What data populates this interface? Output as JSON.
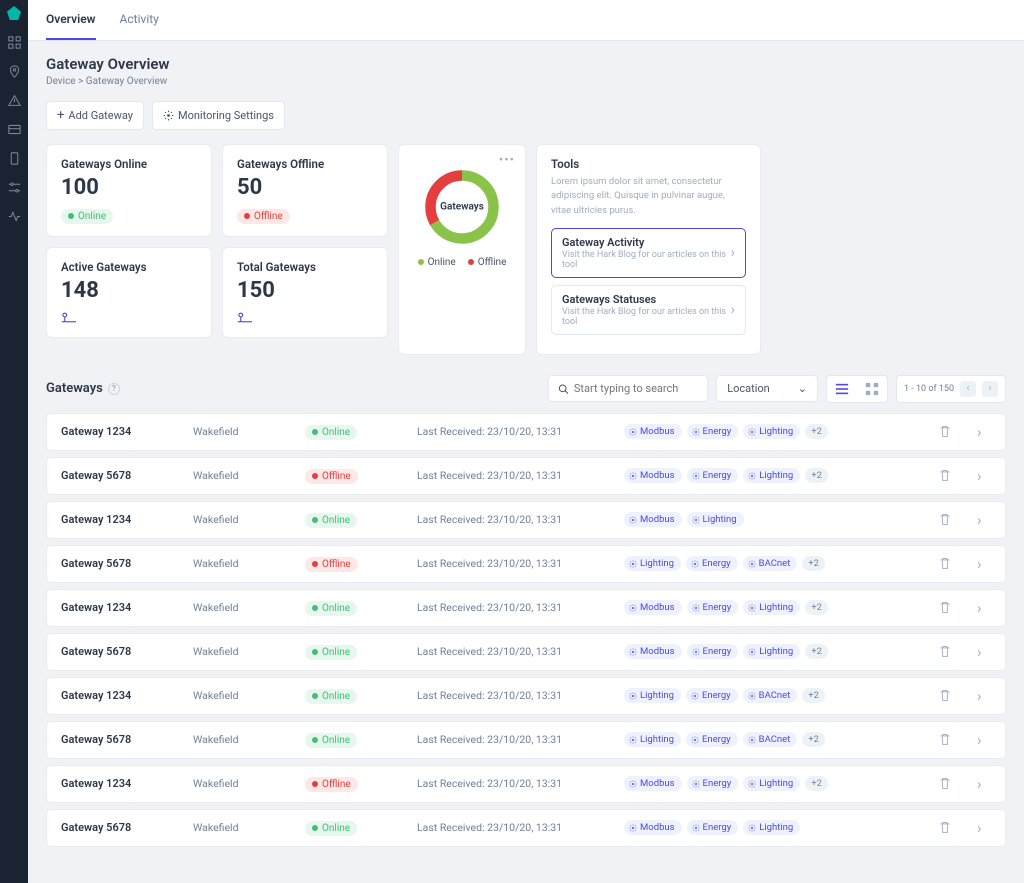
{
  "tabs": {
    "overview": "Overview",
    "activity": "Activity"
  },
  "page": {
    "title": "Gateway Overview",
    "breadcrumb": "Device > Gateway Overview",
    "add_btn": "Add Gateway",
    "monitor_btn": "Monitoring Settings"
  },
  "stats": {
    "online": {
      "label": "Gateways Online",
      "value": "100",
      "badge": "Online"
    },
    "offline": {
      "label": "Gateways Offline",
      "value": "50",
      "badge": "Offline"
    },
    "active": {
      "label": "Active Gateways",
      "value": "148"
    },
    "total": {
      "label": "Total Gateways",
      "value": "150"
    }
  },
  "chart_data": {
    "type": "pie",
    "title": "Gateways",
    "series": [
      {
        "name": "Online",
        "value": 100,
        "color": "#8bc34a"
      },
      {
        "name": "Offline",
        "value": 50,
        "color": "#e53e3e"
      }
    ],
    "legend": {
      "online": "Online",
      "offline": "Offline"
    }
  },
  "tools": {
    "title": "Tools",
    "desc": "Lorem ipsum dolor sit amet, consectetur adipiscing elit. Quisque in pulvinar augue, vitae ultricies purus.",
    "items": [
      {
        "title": "Gateway Activity",
        "sub": "Visit the Hark Blog for our articles on this tool"
      },
      {
        "title": "Gateways Statuses",
        "sub": "Visit the Hark Blog for our articles on this tool"
      }
    ]
  },
  "list": {
    "heading": "Gateways",
    "search_placeholder": "Start typing to search",
    "location_label": "Location",
    "pager": "1 - 10 of 150"
  },
  "rows": [
    {
      "name": "Gateway 1234",
      "loc": "Wakefield",
      "status": "Online",
      "received": "Last Received: 23/10/20, 13:31",
      "tags": [
        "Modbus",
        "Energy",
        "Lighting"
      ],
      "more": "+2"
    },
    {
      "name": "Gateway 5678",
      "loc": "Wakefield",
      "status": "Offline",
      "received": "Last Received: 23/10/20, 13:31",
      "tags": [
        "Modbus",
        "Energy",
        "Lighting"
      ],
      "more": "+2"
    },
    {
      "name": "Gateway 1234",
      "loc": "Wakefield",
      "status": "Online",
      "received": "Last Received: 23/10/20, 13:31",
      "tags": [
        "Modbus",
        "Lighting"
      ],
      "more": ""
    },
    {
      "name": "Gateway 5678",
      "loc": "Wakefield",
      "status": "Offline",
      "received": "Last Received: 23/10/20, 13:31",
      "tags": [
        "Lighting",
        "Energy",
        "BACnet"
      ],
      "more": "+2"
    },
    {
      "name": "Gateway 1234",
      "loc": "Wakefield",
      "status": "Online",
      "received": "Last Received: 23/10/20, 13:31",
      "tags": [
        "Modbus",
        "Energy",
        "Lighting"
      ],
      "more": "+2"
    },
    {
      "name": "Gateway 5678",
      "loc": "Wakefield",
      "status": "Online",
      "received": "Last Received: 23/10/20, 13:31",
      "tags": [
        "Modbus",
        "Energy",
        "Lighting"
      ],
      "more": "+2"
    },
    {
      "name": "Gateway 1234",
      "loc": "Wakefield",
      "status": "Online",
      "received": "Last Received: 23/10/20, 13:31",
      "tags": [
        "Lighting",
        "Energy",
        "BACnet"
      ],
      "more": "+2"
    },
    {
      "name": "Gateway 5678",
      "loc": "Wakefield",
      "status": "Online",
      "received": "Last Received: 23/10/20, 13:31",
      "tags": [
        "Lighting",
        "Energy",
        "BACnet"
      ],
      "more": "+2"
    },
    {
      "name": "Gateway 1234",
      "loc": "Wakefield",
      "status": "Offline",
      "received": "Last Received: 23/10/20, 13:31",
      "tags": [
        "Modbus",
        "Energy",
        "Lighting"
      ],
      "more": "+2"
    },
    {
      "name": "Gateway 5678",
      "loc": "Wakefield",
      "status": "Online",
      "received": "Last Received: 23/10/20, 13:31",
      "tags": [
        "Modbus",
        "Energy",
        "Lighting"
      ],
      "more": ""
    }
  ]
}
